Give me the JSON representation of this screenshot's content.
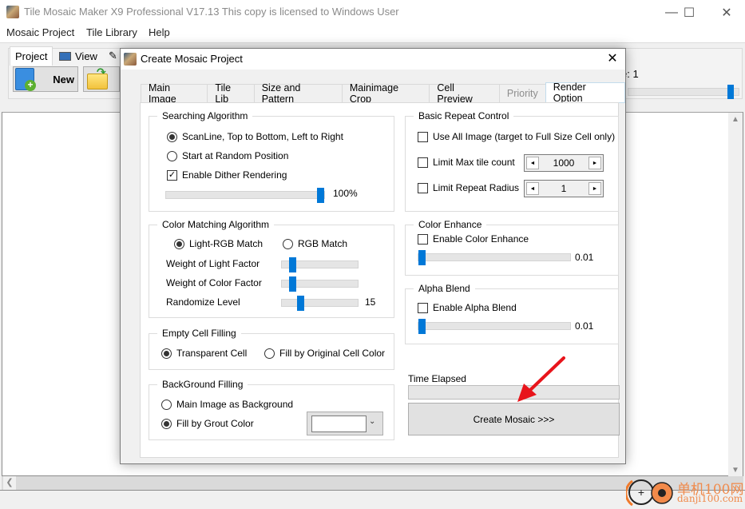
{
  "app": {
    "title": "Tile Mosaic Maker X9 Professional V17.13   This copy is licensed to Windows User",
    "window_controls": {
      "minimize": "—",
      "maximize": "☐",
      "close": "✕"
    }
  },
  "menu": [
    "Mosaic Project",
    "Tile Library",
    "Help"
  ],
  "ribbon": {
    "tabs": [
      {
        "label": "Project",
        "icon": ""
      },
      {
        "label": "View",
        "icon": "monitor-icon"
      },
      {
        "label": "_",
        "icon": "pencil-icon"
      }
    ],
    "new_label": "New",
    "tile_size_partial": "e: 1",
    "slider_fraction": 0.95
  },
  "dialog": {
    "title": "Create Mosaic Project",
    "close": "✕",
    "tabs": [
      {
        "label": "Main Image",
        "state": "normal"
      },
      {
        "label": "Tile Lib",
        "state": "normal"
      },
      {
        "label": "Size and Pattern",
        "state": "normal"
      },
      {
        "label": "Mainimage Crop",
        "state": "normal"
      },
      {
        "label": "Cell Preview",
        "state": "normal"
      },
      {
        "label": "Priority",
        "state": "disabled"
      },
      {
        "label": "Render Option",
        "state": "active"
      }
    ],
    "searching": {
      "title": "Searching Algorithm",
      "scanline": {
        "label": "ScanLine, Top to Bottom, Left to Right",
        "selected": true
      },
      "random": {
        "label": "Start at Random Position",
        "selected": false
      },
      "dither": {
        "label": "Enable Dither Rendering",
        "checked": true
      },
      "dither_value": "100%",
      "dither_fraction": 1.0
    },
    "color_matching": {
      "title": "Color Matching Algorithm",
      "light_rgb": {
        "label": "Light-RGB Match",
        "selected": true
      },
      "rgb": {
        "label": "RGB Match",
        "selected": false
      },
      "light_factor": {
        "label": "Weight of Light Factor",
        "fraction": 0.1
      },
      "color_factor": {
        "label": "Weight of Color Factor",
        "fraction": 0.1
      },
      "randomize": {
        "label": "Randomize Level",
        "value": "15",
        "fraction": 0.22
      }
    },
    "empty_cell": {
      "title": "Empty Cell Filling",
      "transparent": {
        "label": "Transparent Cell",
        "selected": true
      },
      "original": {
        "label": "Fill by Original Cell Color",
        "selected": false
      }
    },
    "background": {
      "title": "BackGround Filling",
      "main_image": {
        "label": "Main Image as Background",
        "selected": false
      },
      "grout": {
        "label": "Fill by Grout Color",
        "selected": true
      },
      "grout_color": "#ffffff"
    },
    "repeat": {
      "title": "Basic Repeat Control",
      "use_all": {
        "label": "Use All Image (target to Full Size Cell only)",
        "checked": false
      },
      "max_tile": {
        "label": "Limit Max tile count",
        "checked": false,
        "value": "1000"
      },
      "radius": {
        "label": "Limit Repeat Radius",
        "checked": false,
        "value": "1"
      }
    },
    "color_enhance": {
      "title": "Color Enhance",
      "enable": {
        "label": "Enable Color Enhance",
        "checked": false
      },
      "value": "0.01",
      "fraction": 0.0
    },
    "alpha_blend": {
      "title": "Alpha Blend",
      "enable": {
        "label": "Enable Alpha Blend",
        "checked": false
      },
      "value": "0.01",
      "fraction": 0.0
    },
    "time_elapsed_label": "Time Elapsed",
    "time_elapsed_value": "",
    "create_button": "Create Mosaic >>>"
  },
  "watermark": {
    "line1": "单机100网",
    "line2": "danji100.com"
  },
  "colors": {
    "accent": "#0078d7",
    "annotation_arrow": "#e8141b",
    "watermark": "#f08a4b"
  }
}
